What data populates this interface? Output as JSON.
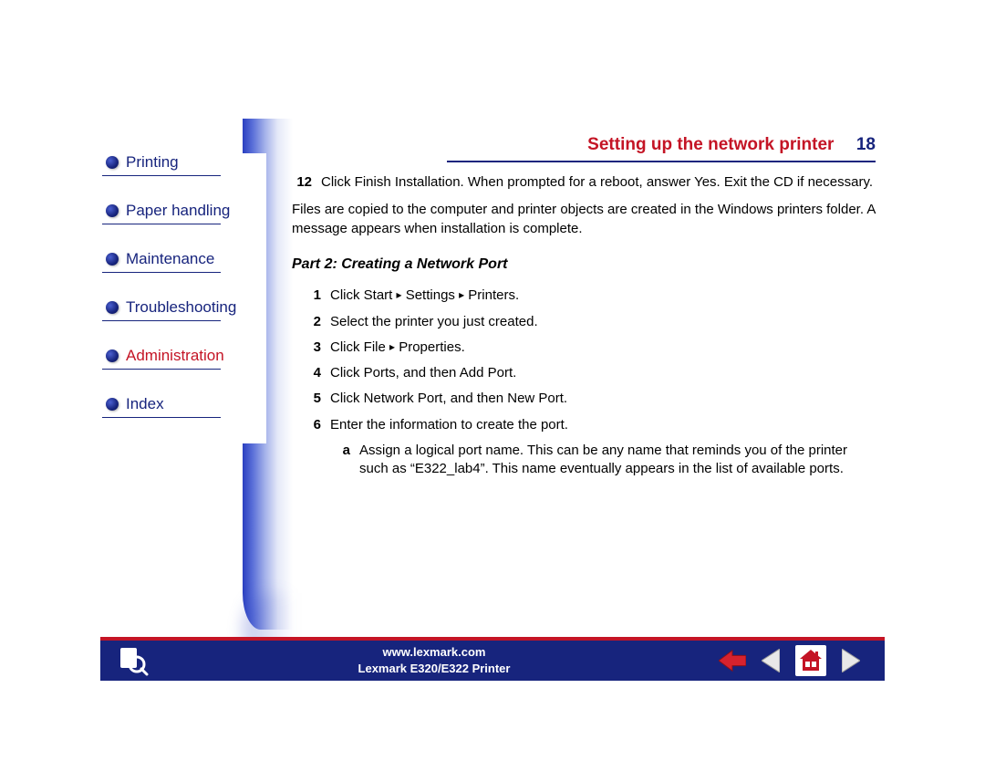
{
  "header": {
    "title": "Setting up the network printer",
    "page_number": "18"
  },
  "sidebar": {
    "items": [
      {
        "label": "Printing",
        "active": false
      },
      {
        "label": "Paper handling",
        "active": false
      },
      {
        "label": "Maintenance",
        "active": false
      },
      {
        "label": "Troubleshooting",
        "active": false
      },
      {
        "label": "Administration",
        "active": true
      },
      {
        "label": "Index",
        "active": false
      }
    ]
  },
  "content": {
    "step12_num": "12",
    "step12_text": "Click Finish Installation. When prompted for a reboot, answer Yes. Exit the CD if necessary.",
    "paragraph": "Files are copied to the computer and printer objects are created in the Windows printers folder. A message appears when installation is complete.",
    "part_heading": "Part 2: Creating a Network Port",
    "steps": [
      {
        "num": "1",
        "text_prefix": "Click Start ",
        "arrow1": "▸",
        "mid": " Settings ",
        "arrow2": "▸",
        "suffix": " Printers."
      },
      {
        "num": "2",
        "plain": "Select the printer you just created."
      },
      {
        "num": "3",
        "text_prefix": "Click File ",
        "arrow1": "▸",
        "suffix": " Properties."
      },
      {
        "num": "4",
        "plain": "Click Ports, and then Add Port."
      },
      {
        "num": "5",
        "plain": "Click Network Port, and then New Port."
      },
      {
        "num": "6",
        "plain": "Enter the information to create the port."
      }
    ],
    "sub_a_num": "a",
    "sub_a_text": "Assign a logical port name. This can be any name that reminds you of the printer such as “E322_lab4”. This name eventually appears in the list of available ports."
  },
  "footer": {
    "url": "www.lexmark.com",
    "product": "Lexmark E320/E322 Printer"
  }
}
